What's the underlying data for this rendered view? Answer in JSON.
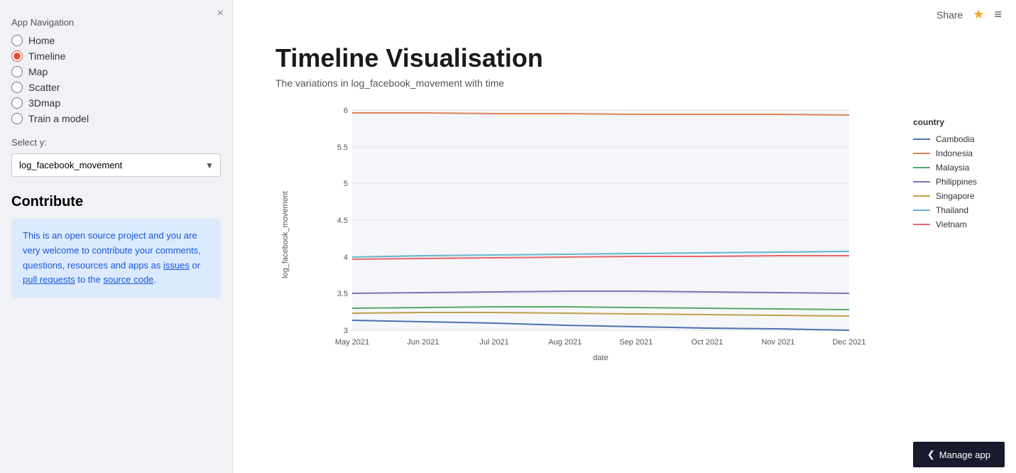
{
  "sidebar": {
    "close_label": "×",
    "nav_label": "App Navigation",
    "nav_items": [
      {
        "label": "Home",
        "value": "home",
        "selected": false
      },
      {
        "label": "Timeline",
        "value": "timeline",
        "selected": true
      },
      {
        "label": "Map",
        "value": "map",
        "selected": false
      },
      {
        "label": "Scatter",
        "value": "scatter",
        "selected": false
      },
      {
        "label": "3Dmap",
        "value": "3dmap",
        "selected": false
      },
      {
        "label": "Train a model",
        "value": "train",
        "selected": false
      }
    ],
    "select_label": "Select y:",
    "select_value": "log_facebook_movement",
    "select_options": [
      {
        "label": "log_facebook_movement",
        "value": "log_facebook_movement"
      }
    ],
    "contribute_title": "Contribute",
    "contribute_text_1": "This is an open source project and you are very welcome to contribute your comments, questions, resources and apps as ",
    "contribute_link1": "issues",
    "contribute_text_2": " or ",
    "contribute_link2": "pull requests",
    "contribute_text_3": " to the ",
    "contribute_link3": "source code",
    "contribute_text_4": "."
  },
  "topbar": {
    "share_label": "Share",
    "star_icon": "★",
    "menu_icon": "≡"
  },
  "main": {
    "title": "Timeline Visualisation",
    "subtitle": "The variations in log_facebook_movement with time",
    "y_axis_label": "log_facebook_movement",
    "x_axis_label": "date",
    "legend_title": "country",
    "legend_items": [
      {
        "label": "Cambodia",
        "color": "#4c72b0"
      },
      {
        "label": "Indonesia",
        "color": "#dd8452"
      },
      {
        "label": "Malaysia",
        "color": "#55a868"
      },
      {
        "label": "Philippines",
        "color": "#8172b2"
      },
      {
        "label": "Singapore",
        "color": "#c09e4c"
      },
      {
        "label": "Thailand",
        "color": "#64b5cd"
      },
      {
        "label": "Vietnam",
        "color": "#e8676b"
      }
    ],
    "x_ticks": [
      "May 2021",
      "Jun 2021",
      "Jul 2021",
      "Aug 2021",
      "Sep 2021",
      "Oct 2021",
      "Nov 2021",
      "Dec 2021"
    ],
    "y_ticks": [
      "3",
      "3.5",
      "4",
      "4.5",
      "5",
      "5.5",
      "6"
    ]
  },
  "bottom_bar": {
    "manage_btn_label": "Manage app",
    "chevron_icon": "❮"
  }
}
